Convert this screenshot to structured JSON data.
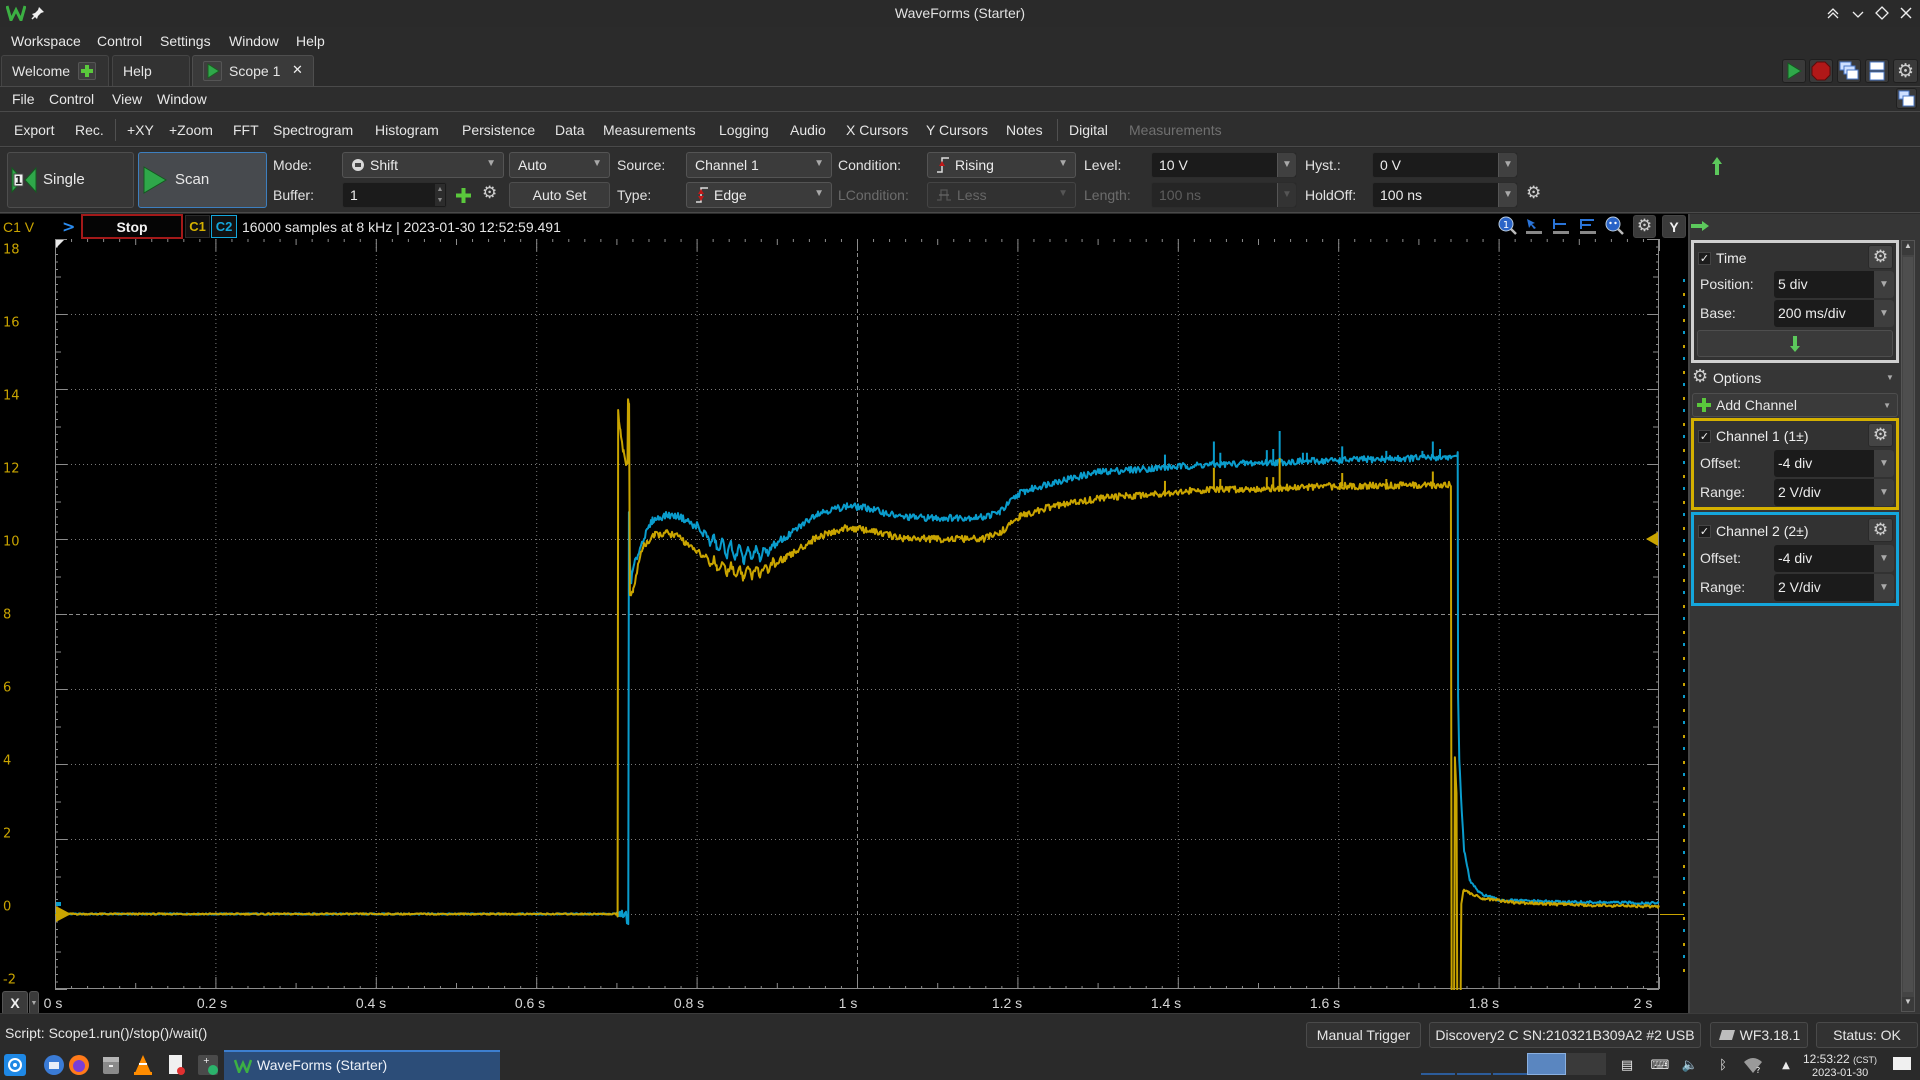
{
  "window": {
    "title": "WaveForms (Starter)"
  },
  "main_menu": [
    "Workspace",
    "Control",
    "Settings",
    "Window",
    "Help"
  ],
  "tabs": [
    {
      "label": "Welcome"
    },
    {
      "label": "Help"
    },
    {
      "label": "Scope 1",
      "active": true
    }
  ],
  "scope_menu": [
    "File",
    "Control",
    "View",
    "Window"
  ],
  "toolbar": [
    {
      "label": "Export"
    },
    {
      "label": "Rec."
    },
    {
      "label": "+XY"
    },
    {
      "label": "+Zoom"
    },
    {
      "label": "FFT"
    },
    {
      "label": "Spectrogram"
    },
    {
      "label": "Histogram"
    },
    {
      "label": "Persistence"
    },
    {
      "label": "Data"
    },
    {
      "label": "Measurements"
    },
    {
      "label": "Logging"
    },
    {
      "label": "Audio"
    },
    {
      "label": "X Cursors"
    },
    {
      "label": "Y Cursors"
    },
    {
      "label": "Notes"
    },
    {
      "label": "Digital"
    },
    {
      "label": "Measurements",
      "disabled": true
    }
  ],
  "acquisition": {
    "single": "Single",
    "scan": "Scan",
    "scan_selected": true
  },
  "trigger": {
    "mode_label": "Mode:",
    "mode_value": "Shift",
    "auto_value": "Auto",
    "source_label": "Source:",
    "source_value": "Channel 1",
    "condition_label": "Condition:",
    "condition_value": "Rising",
    "level_label": "Level:",
    "level_value": "10 V",
    "hyst_label": "Hyst.:",
    "hyst_value": "0 V",
    "buffer_label": "Buffer:",
    "buffer_value": "1",
    "autoset_label": "Auto Set",
    "type_label": "Type:",
    "type_value": "Edge",
    "lcondition_label": "LCondition:",
    "lcondition_value": "Less",
    "length_label": "Length:",
    "length_value": "100 ns",
    "holdoff_label": "HoldOff:",
    "holdoff_value": "100 ns"
  },
  "plot_header": {
    "y_unit_label": "C1 V",
    "stop_label": "Stop",
    "c1_label": "C1",
    "c2_label": "C2",
    "info": "16000 samples at 8 kHz | 2023-01-30 12:52:59.491",
    "y_button": "Y"
  },
  "x_button": "X",
  "right_panel": {
    "time": {
      "title": "Time",
      "checked": true,
      "position_label": "Position:",
      "position_value": "5 div",
      "base_label": "Base:",
      "base_value": "200 ms/div"
    },
    "options_label": "Options",
    "add_channel_label": "Add Channel",
    "channels": [
      {
        "title": "Channel 1 (1±)",
        "checked": true,
        "offset_label": "Offset:",
        "offset_value": "-4 div",
        "range_label": "Range:",
        "range_value": "2 V/div",
        "color": "#d4b000"
      },
      {
        "title": "Channel 2 (2±)",
        "checked": true,
        "offset_label": "Offset:",
        "offset_value": "-4 div",
        "range_label": "Range:",
        "range_value": "2 V/div",
        "color": "#14a6dc"
      }
    ]
  },
  "status_bar": {
    "script": "Script: Scope1.run()/stop()/wait()",
    "manual_trigger": "Manual Trigger",
    "device": "Discovery2 C SN:210321B309A2 #2 USB",
    "version": "WF3.18.1",
    "status": "Status: OK"
  },
  "taskbar": {
    "app_label": "WaveForms (Starter)",
    "time": "12:53:22",
    "timezone": "(CST)",
    "date": "2023-01-30"
  },
  "colors": {
    "channel_1": "#c9a400",
    "channel_2": "#0a9ccc",
    "stop_border": "#a31919",
    "run_green": "#2fa84a",
    "taskbar_active": "#2c4d78"
  },
  "chart_data": {
    "type": "line",
    "title": "",
    "xlabel": "",
    "ylabel": "C1 V",
    "xlim": [
      0,
      2
    ],
    "ylim": [
      -2,
      18
    ],
    "x_ticks": [
      0,
      0.2,
      0.4,
      0.6,
      0.8,
      1.0,
      1.2,
      1.4,
      1.6,
      1.8,
      2.0
    ],
    "x_tick_labels": [
      "0 s",
      "0.2 s",
      "0.4 s",
      "0.6 s",
      "0.8 s",
      "1 s",
      "1.2 s",
      "1.4 s",
      "1.6 s",
      "1.8 s",
      "2 s"
    ],
    "y_ticks": [
      18,
      16,
      14,
      12,
      10,
      8,
      6,
      4,
      2,
      0,
      -2
    ],
    "y_tick_labels": [
      "18",
      "16",
      "14",
      "12",
      "10",
      "8",
      "6",
      "4",
      "2",
      "0",
      "-2"
    ],
    "grid": true,
    "trigger_level": 10,
    "trigger_position_time": 0,
    "series": [
      {
        "name": "Channel 2",
        "color": "#0a9ccc",
        "points": [
          [
            0,
            0
          ],
          [
            0.712,
            0
          ],
          [
            0.7132,
            -0.25
          ],
          [
            0.7148,
            -0.2
          ],
          [
            0.7156,
            10.7
          ],
          [
            0.7165,
            9.4
          ],
          [
            0.7185,
            8.9
          ],
          [
            0.722,
            9.3
          ],
          [
            0.733,
            9.97
          ],
          [
            0.745,
            10.5
          ],
          [
            0.763,
            10.64
          ],
          [
            0.779,
            10.6
          ],
          [
            0.8,
            10.32
          ],
          [
            0.825,
            9.84
          ],
          [
            0.858,
            9.57
          ],
          [
            0.883,
            9.62
          ],
          [
            0.912,
            10.05
          ],
          [
            0.95,
            10.69
          ],
          [
            0.988,
            10.88
          ],
          [
            1.012,
            10.83
          ],
          [
            1.054,
            10.59
          ],
          [
            1.095,
            10.56
          ],
          [
            1.157,
            10.58
          ],
          [
            1.178,
            10.72
          ],
          [
            1.203,
            11.23
          ],
          [
            1.24,
            11.49
          ],
          [
            1.303,
            11.79
          ],
          [
            1.428,
            11.97
          ],
          [
            1.527,
            12.05
          ],
          [
            1.602,
            12.1
          ],
          [
            1.7485,
            12.19
          ],
          [
            1.749,
            12.35
          ],
          [
            1.7495,
            5.8
          ],
          [
            1.751,
            4.1
          ],
          [
            1.754,
            2.77
          ],
          [
            1.757,
            1.7
          ],
          [
            1.764,
            0.9
          ],
          [
            1.776,
            0.56
          ],
          [
            1.8,
            0.37
          ],
          [
            1.88,
            0.32
          ],
          [
            2.0,
            0.29
          ]
        ],
        "spikes": [
          [
            1.384,
            12.25
          ],
          [
            1.445,
            12.6
          ],
          [
            1.453,
            12.3
          ],
          [
            1.511,
            12.37
          ],
          [
            1.519,
            12.4
          ],
          [
            1.527,
            12.88
          ],
          [
            1.556,
            12.3
          ],
          [
            1.561,
            12.3
          ],
          [
            1.605,
            12.47
          ],
          [
            1.66,
            12.35
          ],
          [
            1.705,
            12.35
          ],
          [
            1.718,
            12.6
          ],
          [
            1.727,
            12.4
          ]
        ],
        "ripple": {
          "t_start": 0.785,
          "t_end": 0.915,
          "amplitude": 0.22,
          "period": 0.0105
        }
      },
      {
        "name": "Channel 1",
        "color": "#c9a400",
        "points": [
          [
            0,
            0
          ],
          [
            0.7015,
            0
          ],
          [
            0.7022,
            13.4
          ],
          [
            0.705,
            12.9
          ],
          [
            0.709,
            12.3
          ],
          [
            0.712,
            12.0
          ],
          [
            0.7138,
            12.0
          ],
          [
            0.7145,
            13.8
          ],
          [
            0.7158,
            13.6
          ],
          [
            0.7168,
            8.5
          ],
          [
            0.721,
            8.6
          ],
          [
            0.727,
            9.3
          ],
          [
            0.733,
            9.8
          ],
          [
            0.748,
            10.1
          ],
          [
            0.763,
            10.16
          ],
          [
            0.779,
            10.05
          ],
          [
            0.8,
            9.65
          ],
          [
            0.825,
            9.3
          ],
          [
            0.858,
            9.1
          ],
          [
            0.883,
            9.17
          ],
          [
            0.912,
            9.5
          ],
          [
            0.95,
            10.05
          ],
          [
            0.988,
            10.3
          ],
          [
            1.012,
            10.24
          ],
          [
            1.054,
            10.03
          ],
          [
            1.095,
            10.0
          ],
          [
            1.157,
            10.0
          ],
          [
            1.178,
            10.16
          ],
          [
            1.203,
            10.6
          ],
          [
            1.24,
            10.85
          ],
          [
            1.303,
            11.09
          ],
          [
            1.428,
            11.3
          ],
          [
            1.527,
            11.36
          ],
          [
            1.602,
            11.41
          ],
          [
            1.7405,
            11.44
          ],
          [
            1.7415,
            -2.6
          ],
          [
            1.7445,
            -2.6
          ],
          [
            1.7455,
            4.2
          ],
          [
            1.7475,
            3.2
          ],
          [
            1.7485,
            -2.6
          ],
          [
            1.7525,
            -2.6
          ],
          [
            1.7535,
            0.3
          ],
          [
            1.756,
            0.62
          ],
          [
            1.762,
            0.58
          ],
          [
            1.78,
            0.42
          ],
          [
            1.82,
            0.3
          ],
          [
            1.9,
            0.24
          ],
          [
            2.0,
            0.2
          ]
        ],
        "spikes": [
          [
            1.384,
            11.55
          ],
          [
            1.445,
            11.9
          ],
          [
            1.453,
            11.6
          ],
          [
            1.511,
            11.65
          ],
          [
            1.519,
            11.65
          ],
          [
            1.527,
            12.16
          ],
          [
            1.605,
            11.76
          ],
          [
            1.66,
            11.6
          ],
          [
            1.718,
            11.8
          ]
        ],
        "ripple": {
          "t_start": 0.785,
          "t_end": 0.915,
          "amplitude": 0.2,
          "period": 0.0105
        }
      }
    ]
  }
}
